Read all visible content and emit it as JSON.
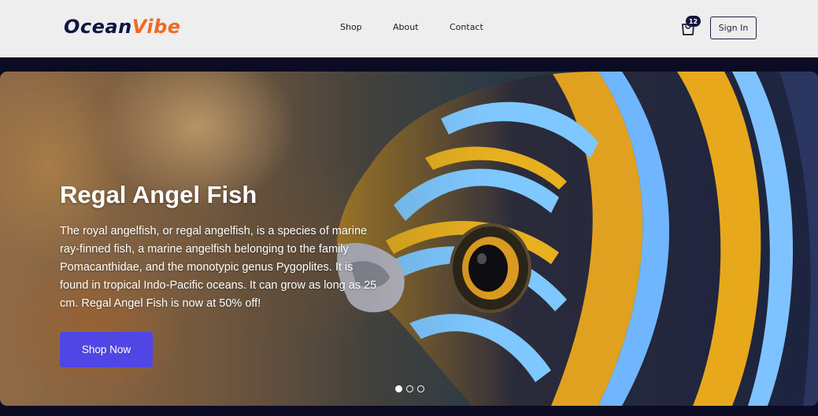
{
  "brand": {
    "part1": "Ocean",
    "part2": "Vibe"
  },
  "nav": {
    "links": [
      {
        "label": "Shop"
      },
      {
        "label": "About"
      },
      {
        "label": "Contact"
      }
    ]
  },
  "cart": {
    "count": "12",
    "icon": "shopping-bag-icon"
  },
  "auth": {
    "signin_label": "Sign In"
  },
  "hero": {
    "title": "Regal Angel Fish",
    "description": "The royal angelfish, or regal angelfish, is a species of marine ray-finned fish, a marine angelfish belonging to the family Pomacanthidae, and the monotypic genus Pygoplites. It is found in tropical Indo-Pacific oceans. It can grow as long as 25 cm. Regal Angel Fish is now at 50% off!",
    "cta_label": "Shop Now",
    "slides_total": 3,
    "slide_active": 1
  },
  "colors": {
    "accent": "#4f46e5",
    "brand_dark": "#0e1540",
    "brand_orange": "#f26a21",
    "navbar_bg": "#eeeeee",
    "page_bg": "#0b0b24"
  }
}
